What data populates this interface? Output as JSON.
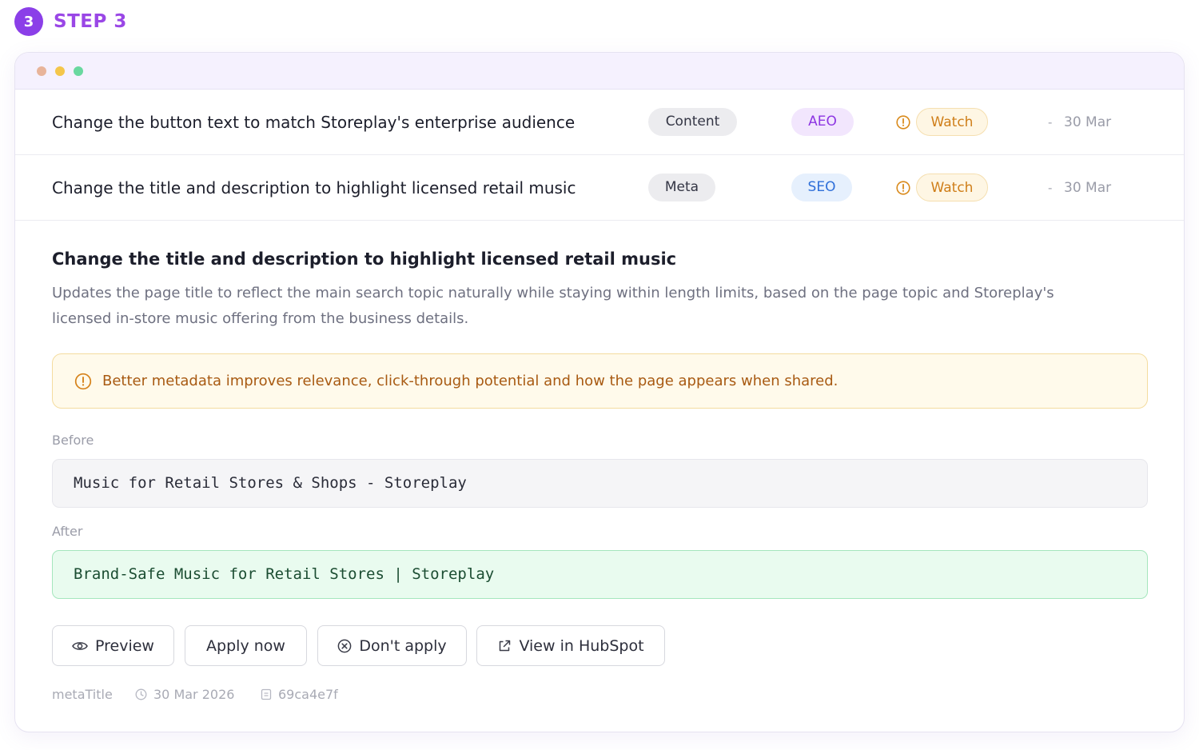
{
  "step": {
    "number": "3",
    "label": "STEP 3"
  },
  "recommendations": [
    {
      "title": "Change the button text to match Storeplay's enterprise audience",
      "category": "Content",
      "type": "AEO",
      "status": "Watch",
      "dash": "-",
      "date": "30 Mar"
    },
    {
      "title": "Change the title and description to highlight licensed retail music",
      "category": "Meta",
      "type": "SEO",
      "status": "Watch",
      "dash": "-",
      "date": "30 Mar"
    }
  ],
  "detail": {
    "title": "Change the title and description to highlight licensed retail music",
    "description": "Updates the page title to reflect the main search topic naturally while staying within length limits, based on the page topic and Storeplay's licensed in-store music offering from the business details.",
    "notice": "Better metadata improves relevance, click-through potential and how the page appears when shared.",
    "before_label": "Before",
    "before_value": "Music for Retail Stores & Shops - Storeplay",
    "after_label": "After",
    "after_value": "Brand-Safe Music for Retail Stores | Storeplay",
    "buttons": {
      "preview": "Preview",
      "apply": "Apply now",
      "dont_apply": "Don't apply",
      "hubspot": "View in HubSpot"
    },
    "meta": {
      "field": "metaTitle",
      "date": "30 Mar 2026",
      "id": "69ca4e7f"
    }
  },
  "colors": {
    "accent": "#8b3fe8",
    "watch": "#cf7e19",
    "aeo": "#8d36e2",
    "seo": "#2f6fd9",
    "after_bg": "#e9fbef"
  }
}
